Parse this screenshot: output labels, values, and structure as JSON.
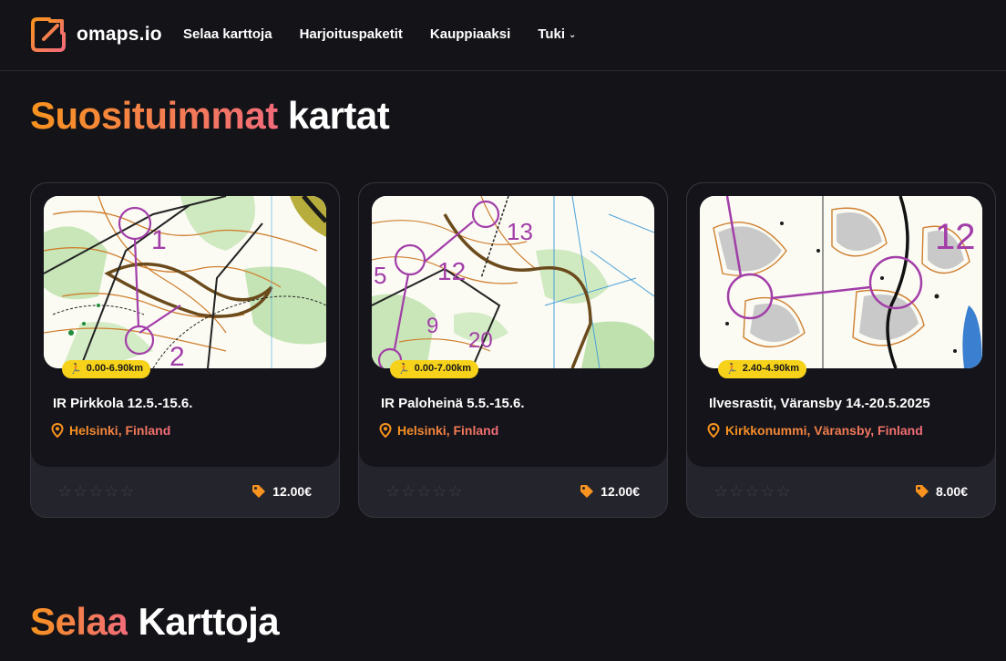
{
  "app": {
    "logo_text": "omaps.io"
  },
  "nav": {
    "items": [
      {
        "label": "Selaa karttoja"
      },
      {
        "label": "Harjoituspaketit"
      },
      {
        "label": "Kauppiaaksi"
      },
      {
        "label": "Tuki"
      }
    ]
  },
  "sections": {
    "popular": {
      "highlight": "Suosituimmat",
      "rest": "kartat"
    },
    "browse": {
      "highlight": "Selaa",
      "rest": "Karttoja"
    }
  },
  "cards": [
    {
      "distance": "0.00-6.90km",
      "title": "IR Pirkkola 12.5.-15.6.",
      "location": "Helsinki, Finland",
      "rating": 0,
      "price": "12.00€"
    },
    {
      "distance": "0.00-7.00km",
      "title": "IR Paloheinä 5.5.-15.6.",
      "location": "Helsinki, Finland",
      "rating": 0,
      "price": "12.00€"
    },
    {
      "distance": "2.40-4.90km",
      "title": "Ilvesrastit, Väransby 14.-20.5.2025",
      "location": "Kirkkonummi, Väransby, Finland",
      "rating": 0,
      "price": "8.00€"
    }
  ],
  "map_labels": [
    [
      "1",
      "2"
    ],
    [
      "13",
      "12",
      "5",
      "9",
      "20"
    ],
    [
      "12"
    ]
  ],
  "colors": {
    "background": "#131318",
    "accent_orange": "#f7931e",
    "accent_pink": "#f26b7a",
    "badge_yellow": "#f6d21a",
    "course_purple": "#a23ea8"
  },
  "icons": {
    "badge": "runner-icon",
    "location": "map-pin-icon",
    "price": "price-tag-icon",
    "rating": "star-icon"
  }
}
